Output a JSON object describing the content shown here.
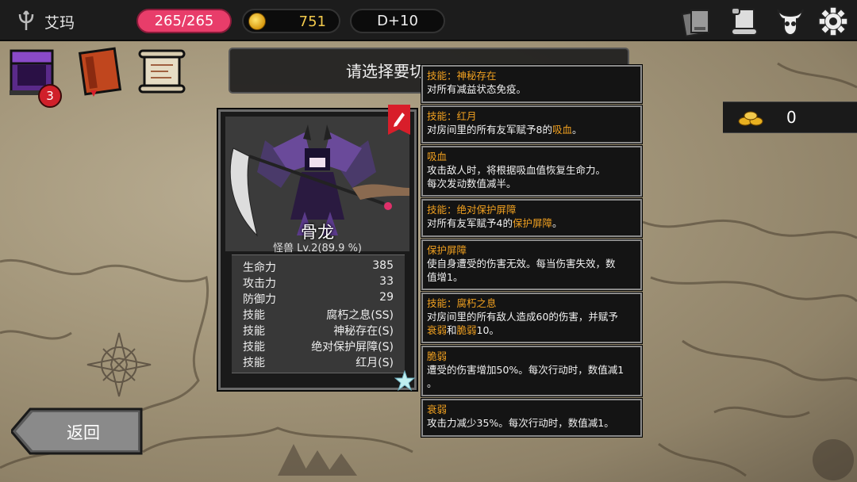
{
  "header": {
    "player_name": "艾玛",
    "hp": "265/265",
    "gold": "751",
    "floor": "D+10"
  },
  "side": {
    "chest_badge": "3"
  },
  "prompt": {
    "text": "请选择要切"
  },
  "card": {
    "name": "骨龙",
    "subtitle": "怪兽 Lv.2(89.9 %)",
    "stats": [
      {
        "key": "生命力",
        "value": "385"
      },
      {
        "key": "攻击力",
        "value": "33"
      },
      {
        "key": "防御力",
        "value": "29"
      },
      {
        "key": "技能",
        "value": "腐朽之息(SS)"
      },
      {
        "key": "技能",
        "value": "神秘存在(S)"
      },
      {
        "key": "技能",
        "value": "绝对保护屏障(S)"
      },
      {
        "key": "技能",
        "value": "红月(S)"
      }
    ]
  },
  "tooltips": [
    {
      "title": "技能：神秘存在",
      "lines": [
        "对所有减益状态免疫。"
      ]
    },
    {
      "title": "技能：红月",
      "line_pre": "对房间里的所有友军赋予8的",
      "line_hl": "吸血",
      "line_post": "。"
    },
    {
      "title": "吸血",
      "lines": [
        "攻击敌人时，将根据吸血值恢复生命力。",
        "每次发动数值减半。"
      ]
    },
    {
      "title": "技能：绝对保护屏障",
      "line_pre": "对所有友军赋予4的",
      "line_hl": "保护屏障",
      "line_post": "。"
    },
    {
      "title": "保护屏障",
      "lines": [
        "使自身遭受的伤害无效。每当伤害失效，数",
        "值增1。"
      ]
    },
    {
      "title": "技能：腐朽之息",
      "line1": "对房间里的所有敌人造成60的伤害，并赋予",
      "l2_hl1": "衰弱",
      "l2_mid": "和",
      "l2_hl2": "脆弱",
      "l2_post": "10。"
    },
    {
      "title": "脆弱",
      "lines": [
        "遭受的伤害增加50%。每次行动时，数值减1",
        "。"
      ]
    },
    {
      "title": "衰弱",
      "lines": [
        "攻击力减少35%。每次行动时，数值减1。"
      ]
    }
  ],
  "gold_right": {
    "value": "0"
  },
  "back_button": {
    "label": "返回"
  },
  "colors": {
    "hp_pill": "#e83d6a",
    "highlight": "#f0a020",
    "gold": "#f2c94c"
  },
  "icons": [
    "trident-icon",
    "coin-icon",
    "card-deck-icon",
    "scroll-icon",
    "demon-skull-icon",
    "gear-icon",
    "chest-icon",
    "book-icon",
    "map-scroll-icon",
    "edit-icon",
    "star-icon",
    "gold-pile-icon"
  ]
}
